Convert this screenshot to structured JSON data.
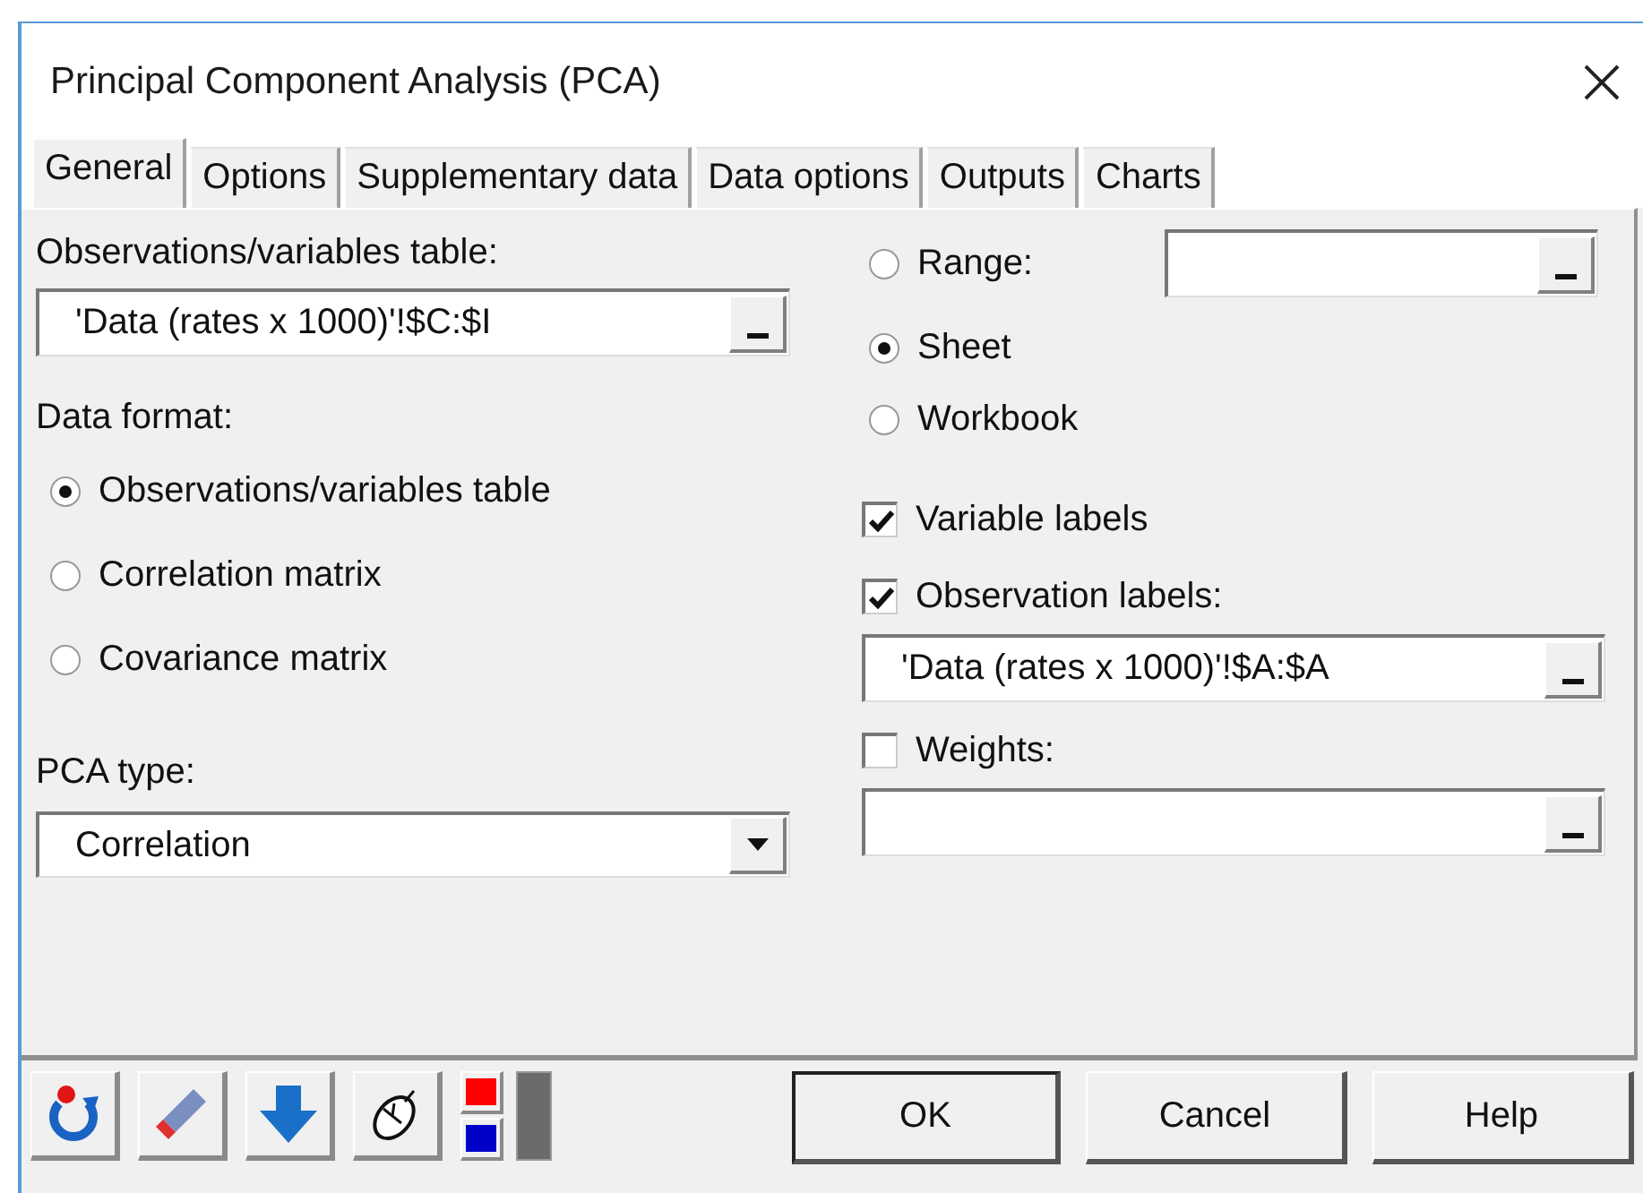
{
  "window": {
    "title": "Principal Component Analysis (PCA)"
  },
  "tabs": [
    {
      "label": "General",
      "selected": true
    },
    {
      "label": "Options",
      "selected": false
    },
    {
      "label": "Supplementary data",
      "selected": false
    },
    {
      "label": "Data options",
      "selected": false
    },
    {
      "label": "Outputs",
      "selected": false
    },
    {
      "label": "Charts",
      "selected": false
    }
  ],
  "table_label": "Observations/variables table:",
  "table_value": "'Data (rates x 1000)'!$C:$I",
  "format_label": "Data format:",
  "formats": [
    {
      "label": "Observations/variables table",
      "selected": true
    },
    {
      "label": "Correlation matrix",
      "selected": false
    },
    {
      "label": "Covariance matrix",
      "selected": false
    }
  ],
  "pca_type_label": "PCA type:",
  "pca_type": "Correlation",
  "locations": [
    {
      "label": "Range:",
      "selected": false
    },
    {
      "label": "Sheet",
      "selected": true
    },
    {
      "label": "Workbook",
      "selected": false
    }
  ],
  "checks": [
    {
      "label": "Variable labels",
      "checked": true
    },
    {
      "label": "Observation labels:",
      "checked": true,
      "field": true,
      "value": "'Data (rates x 1000)'!$A:$A"
    },
    {
      "label": "Weights:",
      "checked": false,
      "field": true
    }
  ],
  "buttons": [
    "OK",
    "Cancel",
    "Help"
  ]
}
